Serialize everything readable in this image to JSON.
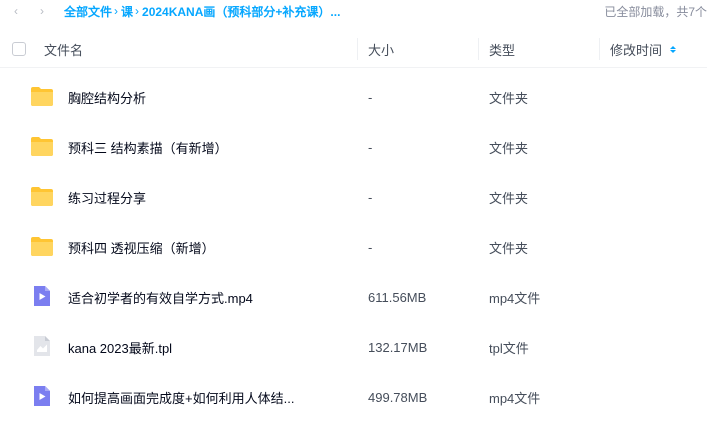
{
  "breadcrumb": {
    "items": [
      "全部文件",
      "课",
      "2024KANA画（预科部分+补充课）..."
    ]
  },
  "load_status": "已全部加载，共7个",
  "table": {
    "columns": {
      "name": "文件名",
      "size": "大小",
      "type": "类型",
      "modified": "修改时间"
    },
    "rows": [
      {
        "icon": "folder-icon",
        "name": "胸腔结构分析",
        "size": "-",
        "type": "文件夹"
      },
      {
        "icon": "folder-icon",
        "name": "预科三 结构素描（有新增）",
        "size": "-",
        "type": "文件夹"
      },
      {
        "icon": "folder-icon",
        "name": "练习过程分享",
        "size": "-",
        "type": "文件夹"
      },
      {
        "icon": "folder-icon",
        "name": "预科四 透视压缩（新增）",
        "size": "-",
        "type": "文件夹"
      },
      {
        "icon": "video-file-icon",
        "name": "适合初学者的有效自学方式.mp4",
        "size": "611.56MB",
        "type": "mp4文件"
      },
      {
        "icon": "tpl-file-icon",
        "name": "kana 2023最新.tpl",
        "size": "132.17MB",
        "type": "tpl文件"
      },
      {
        "icon": "video-file-icon",
        "name": "如何提高画面完成度+如何利用人体结...",
        "size": "499.78MB",
        "type": "mp4文件"
      }
    ]
  },
  "colors": {
    "accent": "#06a7ff",
    "folder": "#ffc533",
    "video": "#7b7ef0",
    "tpl": "#d8dbe2"
  }
}
